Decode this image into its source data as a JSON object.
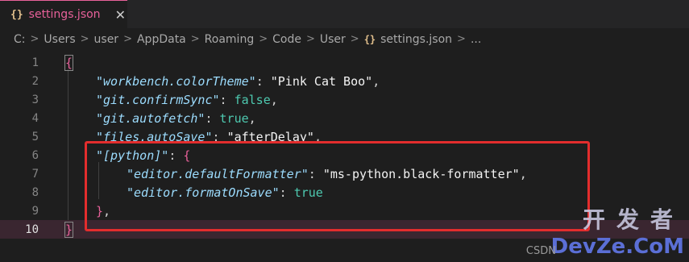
{
  "tab": {
    "icon": "{}",
    "label": "settings.json",
    "close": "✕"
  },
  "breadcrumb": {
    "items": [
      "C:",
      "Users",
      "user",
      "AppData",
      "Roaming",
      "Code",
      "User"
    ],
    "file_icon": "{}",
    "file": "settings.json",
    "more": "..."
  },
  "lines": [
    {
      "num": "1",
      "tokens": [
        [
          "brk",
          "{"
        ]
      ]
    },
    {
      "num": "2",
      "tokens": [
        [
          "k",
          "\"workbench.colorTheme\""
        ],
        [
          "p",
          ": "
        ],
        [
          "s",
          "\"Pink Cat Boo\""
        ],
        [
          "p",
          ","
        ]
      ]
    },
    {
      "num": "3",
      "tokens": [
        [
          "k",
          "\"git.confirmSync\""
        ],
        [
          "p",
          ": "
        ],
        [
          "b",
          "false"
        ],
        [
          "p",
          ","
        ]
      ]
    },
    {
      "num": "4",
      "tokens": [
        [
          "k",
          "\"git.autofetch\""
        ],
        [
          "p",
          ": "
        ],
        [
          "b",
          "true"
        ],
        [
          "p",
          ","
        ]
      ]
    },
    {
      "num": "5",
      "tokens": [
        [
          "k",
          "\"files.autoSave\""
        ],
        [
          "p",
          ": "
        ],
        [
          "s",
          "\"afterDelay\""
        ],
        [
          "p",
          ","
        ]
      ]
    },
    {
      "num": "6",
      "tokens": [
        [
          "k",
          "\"[python]\""
        ],
        [
          "p",
          ": "
        ],
        [
          "brk",
          "{"
        ]
      ]
    },
    {
      "num": "7",
      "tokens": [
        [
          "k",
          "\"editor.defaultFormatter\""
        ],
        [
          "p",
          ": "
        ],
        [
          "s",
          "\"ms-python.black-formatter\""
        ],
        [
          "p",
          ","
        ]
      ]
    },
    {
      "num": "8",
      "tokens": [
        [
          "k",
          "\"editor.formatOnSave\""
        ],
        [
          "p",
          ": "
        ],
        [
          "b",
          "true"
        ]
      ]
    },
    {
      "num": "9",
      "tokens": [
        [
          "brk",
          "}"
        ],
        [
          "p",
          ","
        ]
      ]
    },
    {
      "num": "10",
      "tokens": [
        [
          "brk",
          "}"
        ]
      ]
    }
  ],
  "watermark": {
    "cn": "开发者",
    "en": "DevZe.CoM",
    "csdn": "CSDN"
  },
  "colors": {
    "accent": "#e8619a",
    "highlight_box": "#e32d2d"
  }
}
